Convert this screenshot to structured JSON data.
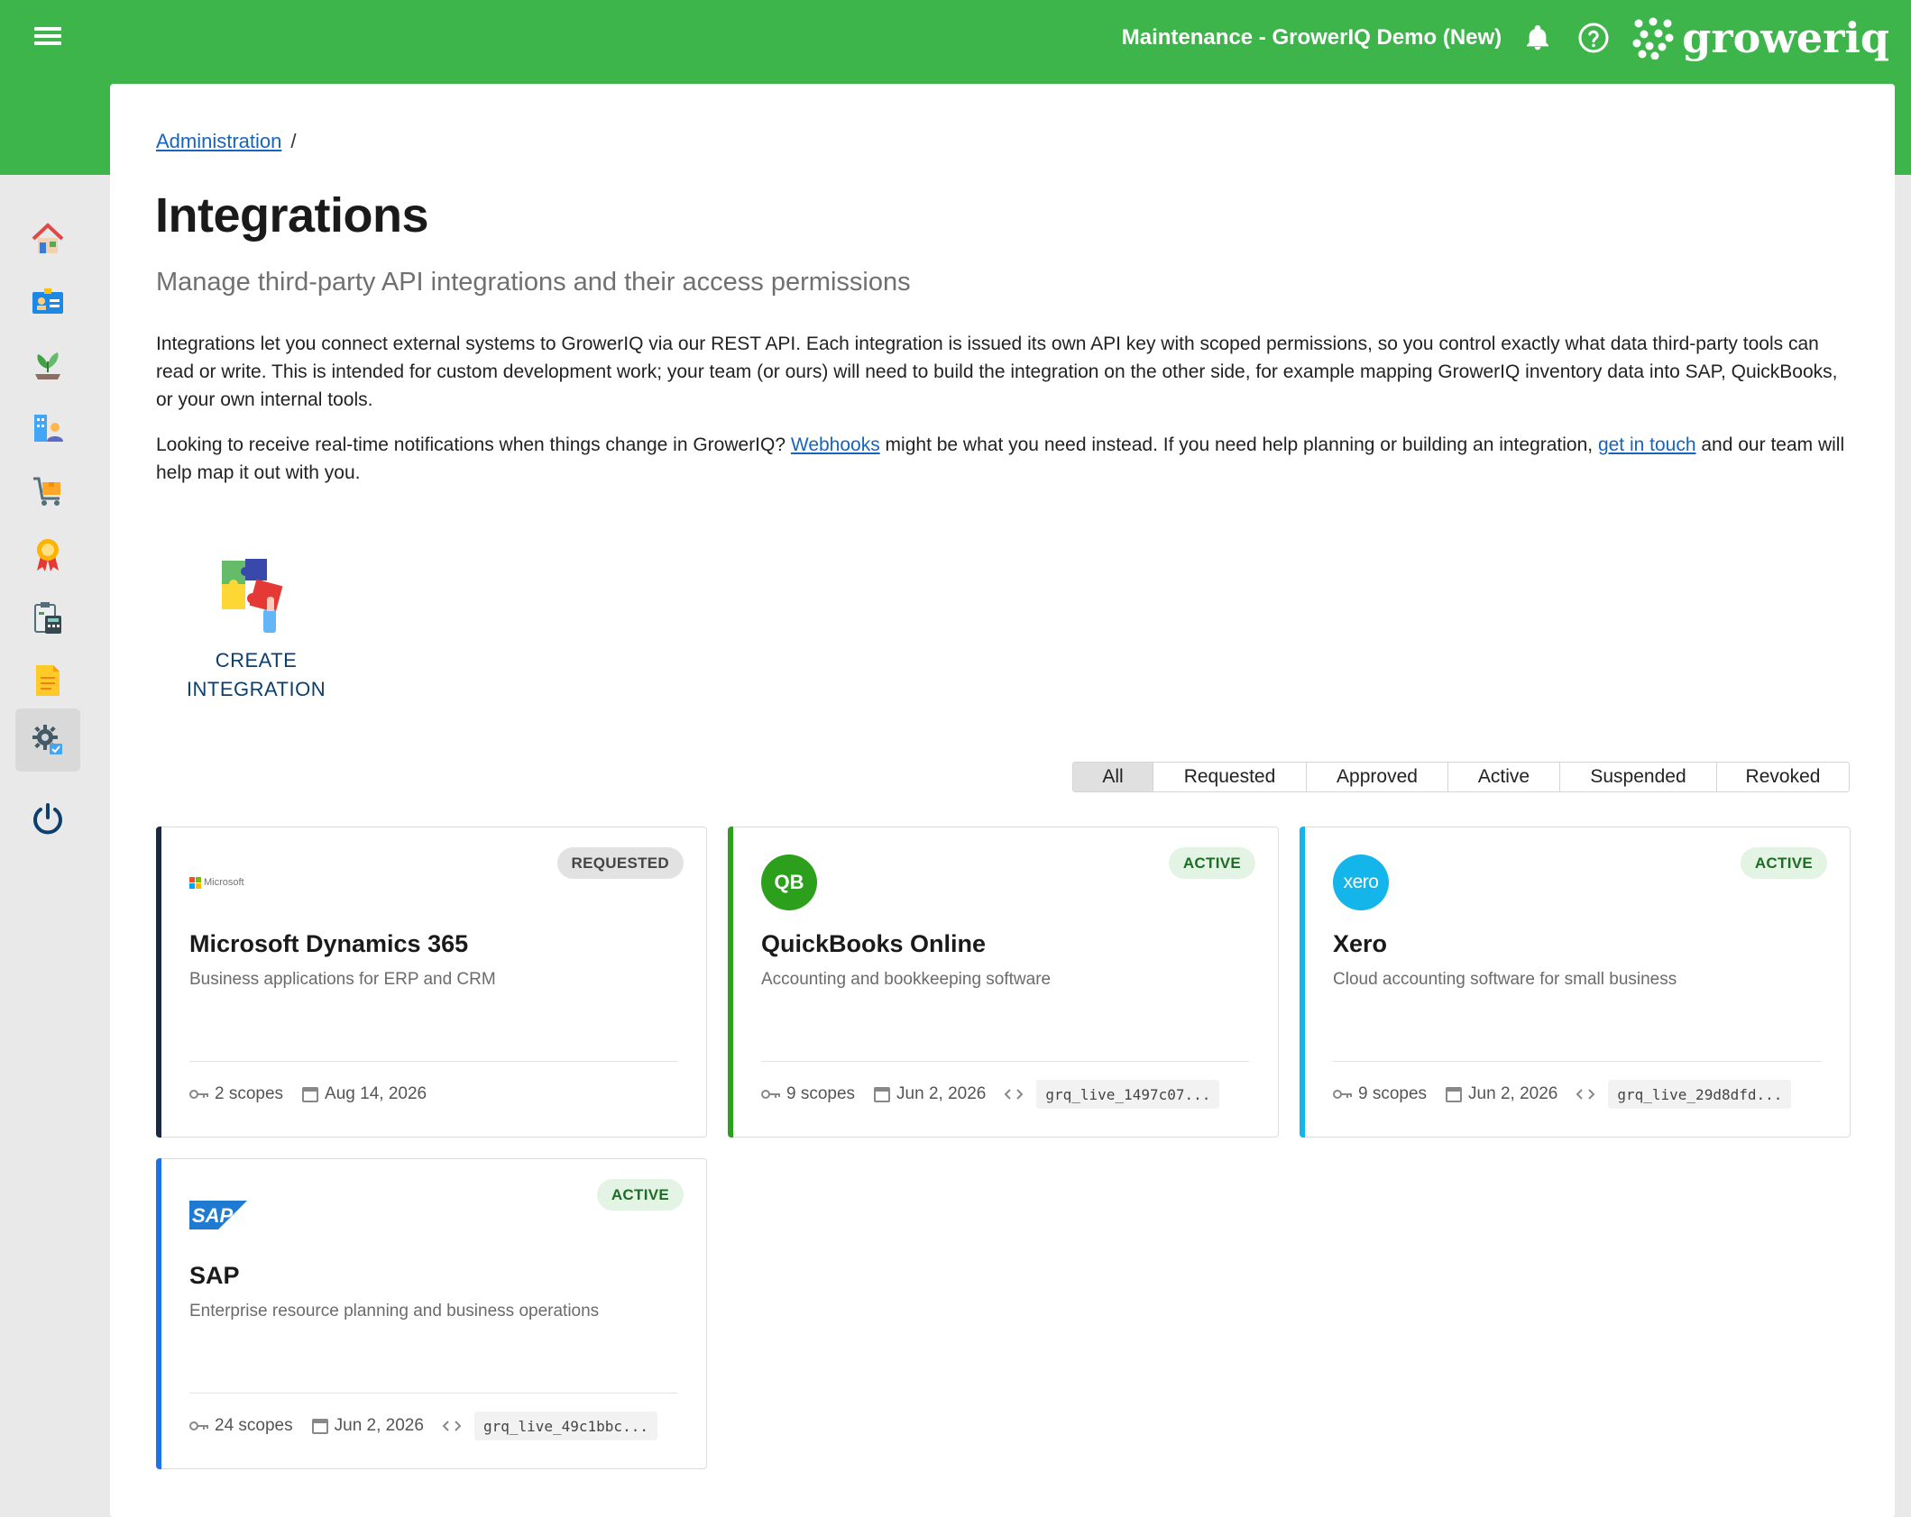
{
  "topbar": {
    "title": "Maintenance - GrowerIQ Demo (New)",
    "logo_text": "groweriq",
    "color": "#3db54a"
  },
  "sidebar": {
    "items": [
      {
        "name": "home-icon"
      },
      {
        "name": "id-card-icon"
      },
      {
        "name": "plant-icon"
      },
      {
        "name": "facility-icon"
      },
      {
        "name": "cart-icon"
      },
      {
        "name": "award-icon"
      },
      {
        "name": "calculator-icon"
      },
      {
        "name": "notes-icon"
      },
      {
        "name": "settings-icon",
        "active": true
      },
      {
        "name": "power-icon"
      }
    ]
  },
  "breadcrumb": {
    "link": "Administration",
    "separator": "/"
  },
  "page": {
    "title": "Integrations",
    "subtitle": "Manage third-party API integrations and their access permissions",
    "paragraph1": "Integrations let you connect external systems to GrowerIQ via our REST API. Each integration is issued its own API key with scoped permissions, so you control exactly what data third-party tools can read or write. This is intended for custom development work; your team (or ours) will need to build the integration on the other side, for example mapping GrowerIQ inventory data into SAP, QuickBooks, or your own internal tools.",
    "paragraph2": {
      "before": "Looking to receive real-time notifications when things change in GrowerIQ? ",
      "link1": "Webhooks",
      "middle": " might be what you need instead. If you need help planning or building an integration, ",
      "link2": "get in touch",
      "after": " and our team will help map it out with you."
    }
  },
  "create": {
    "line1": "CREATE",
    "line2": "INTEGRATION"
  },
  "filters": [
    {
      "label": "All",
      "selected": true
    },
    {
      "label": "Requested"
    },
    {
      "label": "Approved"
    },
    {
      "label": "Active"
    },
    {
      "label": "Suspended"
    },
    {
      "label": "Revoked"
    }
  ],
  "integrations": [
    {
      "name": "Microsoft Dynamics 365",
      "description": "Business applications for ERP and CRM",
      "status": "REQUESTED",
      "logo_text": "Microsoft",
      "scopes": "2 scopes",
      "date": "Aug 14, 2026",
      "key": "",
      "accent": "#1a2a44"
    },
    {
      "name": "QuickBooks Online",
      "description": "Accounting and bookkeeping software",
      "status": "ACTIVE",
      "logo_text": "QB",
      "scopes": "9 scopes",
      "date": "Jun 2, 2026",
      "key": "grq_live_1497c07...",
      "accent": "#2ca01c"
    },
    {
      "name": "Xero",
      "description": "Cloud accounting software for small business",
      "status": "ACTIVE",
      "logo_text": "xero",
      "scopes": "9 scopes",
      "date": "Jun 2, 2026",
      "key": "grq_live_29d8dfd...",
      "accent": "#13b5ea"
    },
    {
      "name": "SAP",
      "description": "Enterprise resource planning and business operations",
      "status": "ACTIVE",
      "logo_text": "SAP",
      "scopes": "24 scopes",
      "date": "Jun 2, 2026",
      "key": "grq_live_49c1bbc...",
      "accent": "#1a73e8"
    }
  ]
}
